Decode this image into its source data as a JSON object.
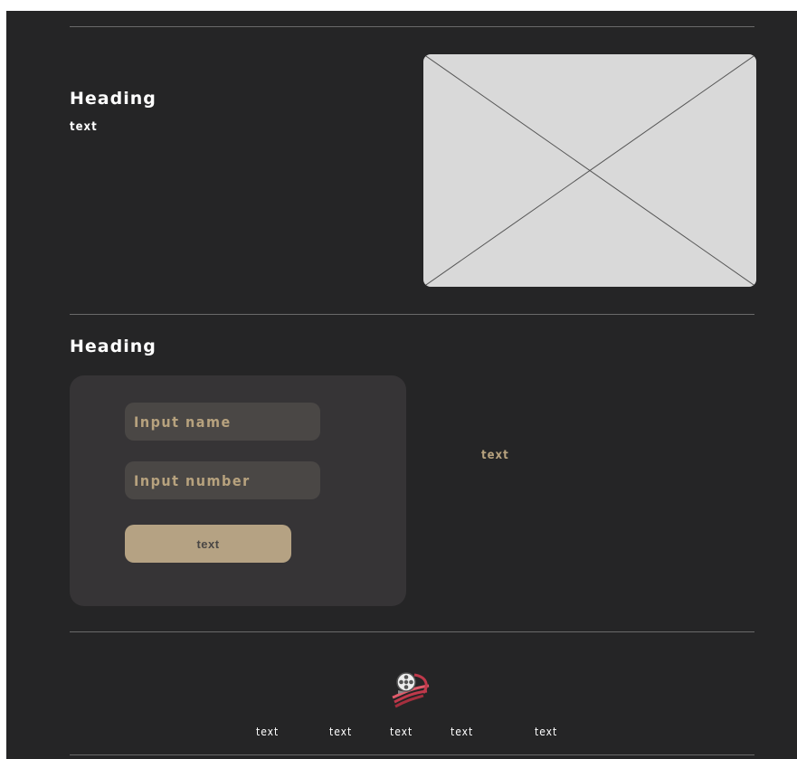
{
  "hero": {
    "heading": "Heading",
    "text": "text"
  },
  "contact": {
    "heading": "Heading",
    "name_placeholder": "Input name",
    "number_placeholder": "Input number",
    "submit_label": "text",
    "side_text": "text"
  },
  "footer": {
    "links": [
      "text",
      "text",
      "text",
      "text",
      "text"
    ]
  },
  "colors": {
    "background": "#252526",
    "card": "#363436",
    "input": "#4a4745",
    "accent": "#b5a283",
    "accent_text": "#b7a27e"
  },
  "icons": {
    "logo": "film-reel-logo-icon",
    "image_placeholder": "image-placeholder-icon"
  }
}
